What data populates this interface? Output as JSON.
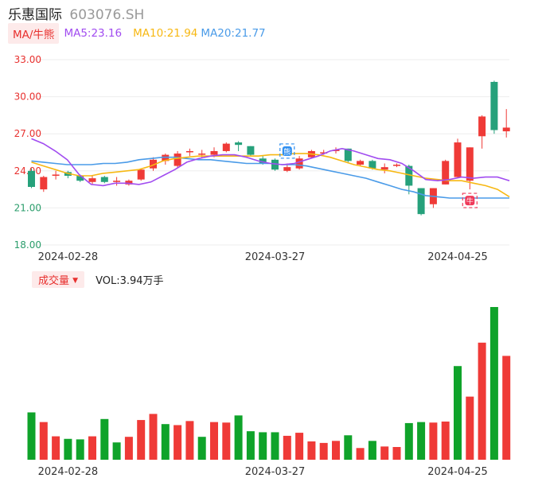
{
  "header": {
    "name": "乐惠国际",
    "code": "603076.SH"
  },
  "legend": {
    "ma_tag": "MA/牛熊",
    "ma5": "MA5:23.16",
    "ma10": "MA10:21.94",
    "ma20": "MA20:21.77"
  },
  "volume_legend": {
    "tag": "成交量",
    "value": "VOL:3.94万手"
  },
  "colors": {
    "up": "#ef3a37",
    "down": "#0fa32a",
    "down_candle": "#26a17b",
    "ma5": "#a14cf0",
    "ma10": "#f7b813",
    "ma20": "#4a9be8",
    "grid": "#eeeeee"
  },
  "icons": [
    "bear-marker-icon",
    "bull-marker-icon"
  ],
  "chart_data": [
    {
      "type": "candlestick",
      "y_ticks": [
        "33.00",
        "30.00",
        "27.00",
        "24.00",
        "21.00",
        "18.00"
      ],
      "ylim": [
        18,
        33
      ],
      "x_tick_labels": [
        {
          "index": 3,
          "label": "2024-02-28"
        },
        {
          "index": 20,
          "label": "2024-03-27"
        },
        {
          "index": 35,
          "label": "2024-04-25"
        }
      ],
      "candles": [
        {
          "o": 24.0,
          "c": 22.7,
          "h": 24.2,
          "l": 22.6
        },
        {
          "o": 22.5,
          "c": 23.5,
          "h": 23.6,
          "l": 22.3
        },
        {
          "o": 23.6,
          "c": 23.7,
          "h": 24.0,
          "l": 23.3
        },
        {
          "o": 23.9,
          "c": 23.6,
          "h": 24.0,
          "l": 23.4
        },
        {
          "o": 23.6,
          "c": 23.2,
          "h": 23.7,
          "l": 23.1
        },
        {
          "o": 23.1,
          "c": 23.4,
          "h": 23.6,
          "l": 22.9
        },
        {
          "o": 23.5,
          "c": 23.1,
          "h": 23.6,
          "l": 23.0
        },
        {
          "o": 23.1,
          "c": 23.2,
          "h": 23.5,
          "l": 22.8
        },
        {
          "o": 22.9,
          "c": 23.2,
          "h": 23.3,
          "l": 22.8
        },
        {
          "o": 23.3,
          "c": 24.1,
          "h": 24.2,
          "l": 23.2
        },
        {
          "o": 24.2,
          "c": 24.9,
          "h": 25.1,
          "l": 24.0
        },
        {
          "o": 24.8,
          "c": 25.3,
          "h": 25.4,
          "l": 24.5
        },
        {
          "o": 24.4,
          "c": 25.4,
          "h": 25.6,
          "l": 24.2
        },
        {
          "o": 25.5,
          "c": 25.6,
          "h": 25.8,
          "l": 25.2
        },
        {
          "o": 25.3,
          "c": 25.4,
          "h": 25.7,
          "l": 25.0
        },
        {
          "o": 25.3,
          "c": 25.6,
          "h": 25.9,
          "l": 25.1
        },
        {
          "o": 25.6,
          "c": 26.2,
          "h": 26.3,
          "l": 25.5
        },
        {
          "o": 26.3,
          "c": 26.1,
          "h": 26.4,
          "l": 25.6
        },
        {
          "o": 26.0,
          "c": 25.3,
          "h": 26.0,
          "l": 25.2
        },
        {
          "o": 25.0,
          "c": 24.6,
          "h": 25.2,
          "l": 24.5
        },
        {
          "o": 24.9,
          "c": 24.1,
          "h": 25.0,
          "l": 24.0
        },
        {
          "o": 24.0,
          "c": 24.3,
          "h": 24.6,
          "l": 23.9
        },
        {
          "o": 24.2,
          "c": 25.0,
          "h": 25.2,
          "l": 24.1
        },
        {
          "o": 25.1,
          "c": 25.6,
          "h": 25.7,
          "l": 25.0
        },
        {
          "o": 25.4,
          "c": 25.5,
          "h": 25.7,
          "l": 25.3
        },
        {
          "o": 25.6,
          "c": 25.7,
          "h": 25.9,
          "l": 25.4
        },
        {
          "o": 25.8,
          "c": 24.8,
          "h": 25.8,
          "l": 24.6
        },
        {
          "o": 24.5,
          "c": 24.8,
          "h": 24.9,
          "l": 24.4
        },
        {
          "o": 24.8,
          "c": 24.2,
          "h": 24.9,
          "l": 24.1
        },
        {
          "o": 24.1,
          "c": 24.3,
          "h": 24.6,
          "l": 23.8
        },
        {
          "o": 24.4,
          "c": 24.5,
          "h": 24.6,
          "l": 24.3
        },
        {
          "o": 24.4,
          "c": 22.8,
          "h": 24.5,
          "l": 22.1
        },
        {
          "o": 22.6,
          "c": 20.5,
          "h": 22.6,
          "l": 20.4
        },
        {
          "o": 21.3,
          "c": 22.6,
          "h": 22.6,
          "l": 21.0
        },
        {
          "o": 22.9,
          "c": 24.8,
          "h": 24.9,
          "l": 22.9
        },
        {
          "o": 23.5,
          "c": 26.3,
          "h": 26.6,
          "l": 23.4
        },
        {
          "o": 23.2,
          "c": 25.9,
          "h": 25.9,
          "l": 22.5
        },
        {
          "o": 26.8,
          "c": 28.4,
          "h": 28.5,
          "l": 25.8
        },
        {
          "o": 31.2,
          "c": 27.3,
          "h": 31.3,
          "l": 27.0
        },
        {
          "o": 27.2,
          "c": 27.5,
          "h": 29.0,
          "l": 26.7
        }
      ],
      "ma5": [
        26.6,
        26.2,
        25.6,
        24.9,
        23.7,
        22.9,
        22.8,
        23.0,
        23.0,
        22.9,
        23.1,
        23.6,
        24.1,
        24.7,
        25.0,
        25.2,
        25.3,
        25.3,
        25.1,
        24.8,
        24.6,
        24.5,
        24.6,
        24.9,
        25.2,
        25.6,
        25.8,
        25.6,
        25.3,
        25.0,
        24.9,
        24.6,
        24.0,
        23.3,
        23.2,
        23.3,
        23.5,
        23.4,
        23.5,
        23.5,
        23.2
      ],
      "ma10": [
        24.7,
        24.4,
        24.1,
        23.8,
        23.6,
        23.6,
        23.8,
        23.9,
        24.0,
        24.1,
        24.4,
        24.8,
        25.0,
        25.1,
        25.2,
        25.2,
        25.2,
        25.2,
        25.2,
        25.2,
        25.3,
        25.3,
        25.4,
        25.4,
        25.3,
        25.1,
        24.8,
        24.5,
        24.3,
        24.1,
        24.0,
        23.8,
        23.6,
        23.4,
        23.3,
        23.2,
        23.2,
        23.0,
        22.8,
        22.5,
        21.9
      ],
      "ma20": [
        24.8,
        24.7,
        24.6,
        24.5,
        24.5,
        24.5,
        24.6,
        24.6,
        24.7,
        24.9,
        25.0,
        25.1,
        25.1,
        25.0,
        24.9,
        24.9,
        24.8,
        24.7,
        24.6,
        24.6,
        24.6,
        24.5,
        24.5,
        24.4,
        24.2,
        24.0,
        23.8,
        23.6,
        23.4,
        23.1,
        22.8,
        22.5,
        22.3,
        22.0,
        21.9,
        21.8,
        21.8,
        21.8,
        21.8,
        21.8,
        21.8
      ],
      "markers": [
        {
          "index": 21,
          "price": 25.6,
          "kind": "bear"
        },
        {
          "index": 36,
          "price": 21.6,
          "kind": "bull"
        }
      ]
    },
    {
      "type": "bar",
      "title": "成交量",
      "units": "万手",
      "x_tick_labels": [
        "2024-02-28",
        "2024-03-27",
        "2024-04-25"
      ],
      "values": [
        {
          "v": 0.93,
          "up": false
        },
        {
          "v": 0.74,
          "up": true
        },
        {
          "v": 0.46,
          "up": true
        },
        {
          "v": 0.41,
          "up": false
        },
        {
          "v": 0.4,
          "up": false
        },
        {
          "v": 0.46,
          "up": true
        },
        {
          "v": 0.8,
          "up": false
        },
        {
          "v": 0.34,
          "up": false
        },
        {
          "v": 0.45,
          "up": true
        },
        {
          "v": 0.78,
          "up": true
        },
        {
          "v": 0.9,
          "up": true
        },
        {
          "v": 0.7,
          "up": false
        },
        {
          "v": 0.68,
          "up": true
        },
        {
          "v": 0.76,
          "up": true
        },
        {
          "v": 0.45,
          "up": false
        },
        {
          "v": 0.74,
          "up": true
        },
        {
          "v": 0.73,
          "up": true
        },
        {
          "v": 0.87,
          "up": false
        },
        {
          "v": 0.56,
          "up": false
        },
        {
          "v": 0.54,
          "up": false
        },
        {
          "v": 0.54,
          "up": false
        },
        {
          "v": 0.47,
          "up": true
        },
        {
          "v": 0.53,
          "up": true
        },
        {
          "v": 0.36,
          "up": true
        },
        {
          "v": 0.33,
          "up": true
        },
        {
          "v": 0.37,
          "up": true
        },
        {
          "v": 0.48,
          "up": false
        },
        {
          "v": 0.23,
          "up": true
        },
        {
          "v": 0.37,
          "up": false
        },
        {
          "v": 0.26,
          "up": true
        },
        {
          "v": 0.25,
          "up": true
        },
        {
          "v": 0.72,
          "up": false
        },
        {
          "v": 0.74,
          "up": false
        },
        {
          "v": 0.73,
          "up": true
        },
        {
          "v": 0.75,
          "up": true
        },
        {
          "v": 1.84,
          "up": false
        },
        {
          "v": 1.24,
          "up": true
        },
        {
          "v": 2.3,
          "up": true
        },
        {
          "v": 3.0,
          "up": false
        },
        {
          "v": 2.04,
          "up": true
        }
      ]
    }
  ]
}
